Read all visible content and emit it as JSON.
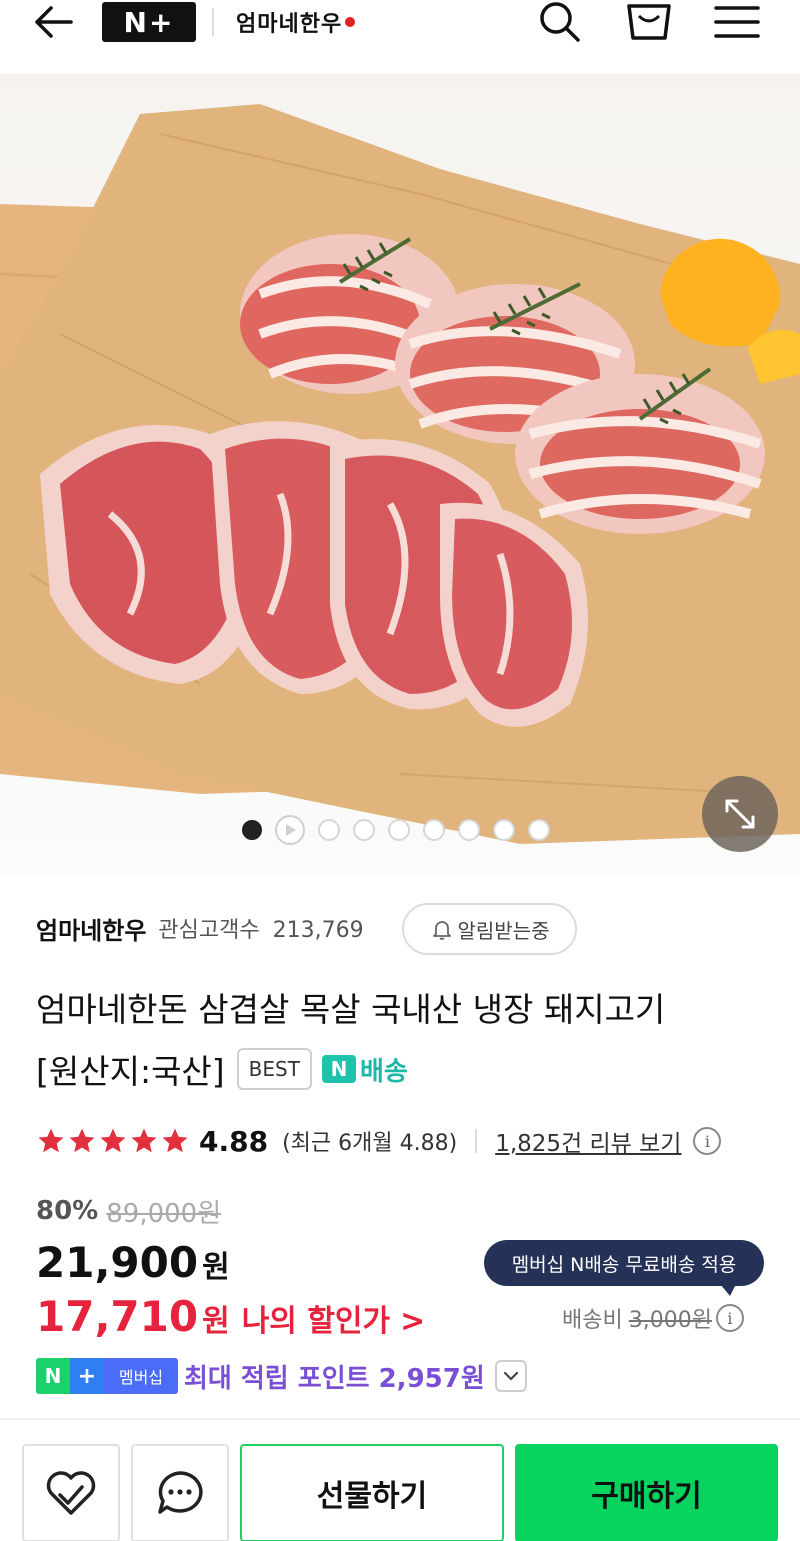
{
  "header": {
    "brand_logo": "N+",
    "store_logo": "엄마네한우",
    "icons": [
      "back-arrow-icon",
      "search-icon",
      "cart-icon",
      "menu-icon"
    ]
  },
  "gallery": {
    "total_images": 9,
    "current_index": 1,
    "has_video": true
  },
  "store": {
    "name": "엄마네한우",
    "watchers_label": "관심고객수",
    "watchers_count": "213,769",
    "alarm_label": "알림받는중"
  },
  "product": {
    "title_line1": "엄마네한돈 삼겹살 목살 국내산 냉장 돼지고기",
    "title_line2": "[원산지:국산]",
    "badge": "BEST",
    "delivery_badge": "배송",
    "delivery_badge_icon": "N"
  },
  "rating": {
    "stars": 5,
    "score": "4.88",
    "recent": "(최근 6개월 4.88)",
    "reviews_link": "1,825건 리뷰 보기"
  },
  "price": {
    "discount_rate": "80%",
    "original": "89,000원",
    "sale": "21,900",
    "unit": "원",
    "my_price": "17,710",
    "my_unit": "원",
    "my_label": "나의 할인가",
    "my_arrow": ">"
  },
  "shipping": {
    "tooltip": "멤버십 N배송 무료배송 적용",
    "label": "배송비",
    "fee": "3,000원"
  },
  "points": {
    "badge_n": "N",
    "badge_plus": "+",
    "badge_membership": "멤버십",
    "text": "최대 적립 포인트 2,957원"
  },
  "bottom_bar": {
    "gift_label": "선물하기",
    "buy_label": "구매하기"
  },
  "colors": {
    "sale_red": "#e6223c",
    "points_purple": "#7a4fd6",
    "buy_green": "#06d45f",
    "tooltip_navy": "#253157",
    "delivery_teal": "#1fb8a8"
  }
}
